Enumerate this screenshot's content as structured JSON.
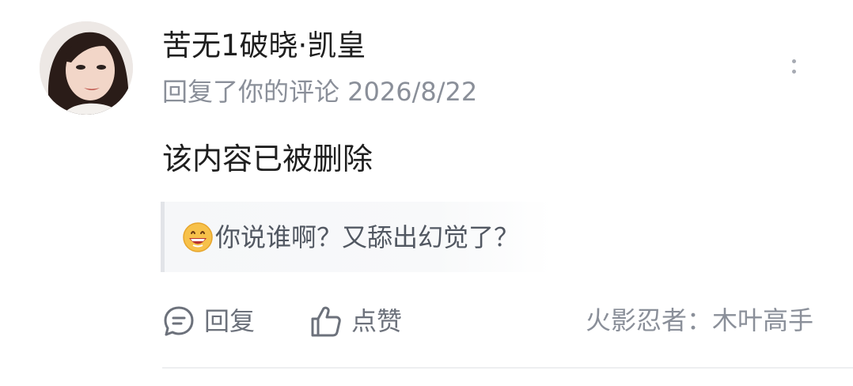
{
  "comment": {
    "username": "苦无1破晓·凯皇",
    "meta": "回复了你的评论 2026/8/22",
    "content": "该内容已被删除",
    "quote": "你说谁啊？又舔出幻觉了？",
    "quote_emoji": "grinning-face-emoji"
  },
  "actions": {
    "reply_label": "回复",
    "like_label": "点赞"
  },
  "source": "火影忍者：木叶高手",
  "colors": {
    "text_primary": "#1f1f1f",
    "text_secondary": "#8a8f99",
    "action_text": "#6c717b",
    "quote_background": "#f6f7f9",
    "quote_border": "#e2e4e8"
  }
}
